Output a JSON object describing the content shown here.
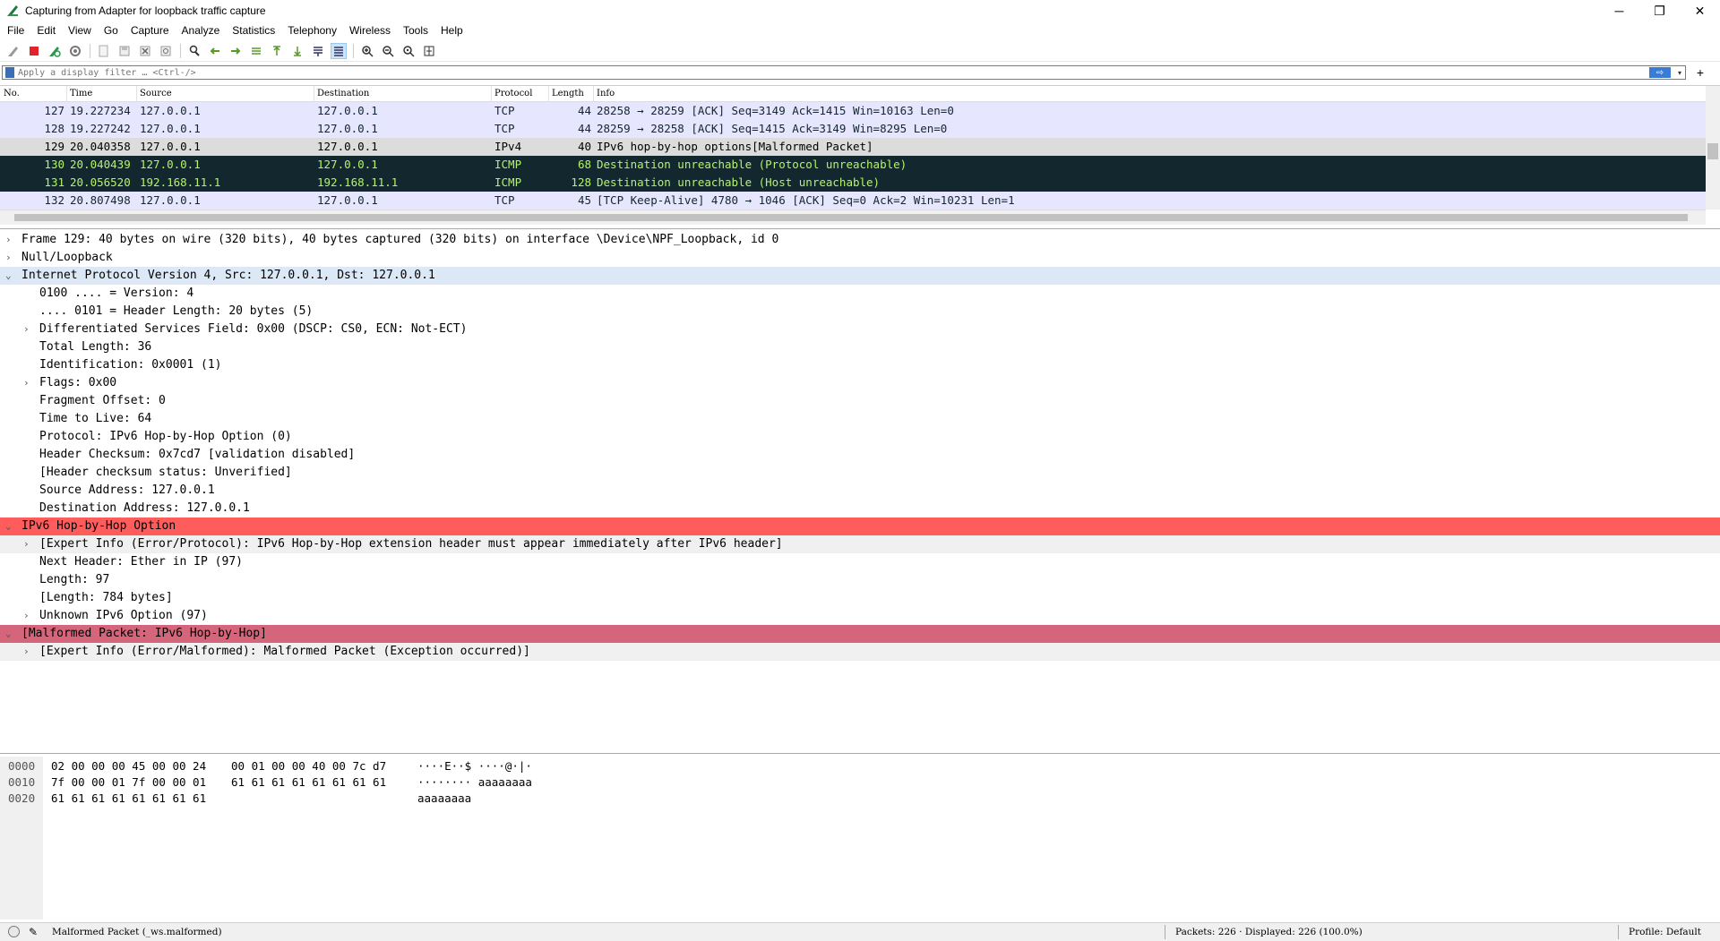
{
  "window": {
    "title": "Capturing from Adapter for loopback traffic capture",
    "minimize": "─",
    "restore": "❐",
    "close": "✕"
  },
  "menu": [
    "File",
    "Edit",
    "View",
    "Go",
    "Capture",
    "Analyze",
    "Statistics",
    "Telephony",
    "Wireless",
    "Tools",
    "Help"
  ],
  "filter": {
    "placeholder": "Apply a display filter … <Ctrl-/>",
    "plus": "+"
  },
  "packet_list": {
    "columns": [
      "No.",
      "Time",
      "Source",
      "Destination",
      "Protocol",
      "Length",
      "Info"
    ],
    "rows": [
      {
        "no": "127",
        "time": "19.227234",
        "src": "127.0.0.1",
        "dst": "127.0.0.1",
        "proto": "TCP",
        "len": "44",
        "info": "28258 → 28259 [ACK] Seq=3149 Ack=1415 Win=10163 Len=0",
        "bg": "#e7e6ff",
        "fg": "#12272e"
      },
      {
        "no": "128",
        "time": "19.227242",
        "src": "127.0.0.1",
        "dst": "127.0.0.1",
        "proto": "TCP",
        "len": "44",
        "info": "28259 → 28258 [ACK] Seq=1415 Ack=3149 Win=8295 Len=0",
        "bg": "#e7e6ff",
        "fg": "#12272e"
      },
      {
        "no": "129",
        "time": "20.040358",
        "src": "127.0.0.1",
        "dst": "127.0.0.1",
        "proto": "IPv4",
        "len": "40",
        "info": "IPv6 hop-by-hop options[Malformed Packet]",
        "bg": "#dcdcdc",
        "fg": "#000000"
      },
      {
        "no": "130",
        "time": "20.040439",
        "src": "127.0.0.1",
        "dst": "127.0.0.1",
        "proto": "ICMP",
        "len": "68",
        "info": "Destination unreachable (Protocol unreachable)",
        "bg": "#12272e",
        "fg": "#b5f466"
      },
      {
        "no": "131",
        "time": "20.056520",
        "src": "192.168.11.1",
        "dst": "192.168.11.1",
        "proto": "ICMP",
        "len": "128",
        "info": "Destination unreachable (Host unreachable)",
        "bg": "#12272e",
        "fg": "#b5f466"
      },
      {
        "no": "132",
        "time": "20.807498",
        "src": "127.0.0.1",
        "dst": "127.0.0.1",
        "proto": "TCP",
        "len": "45",
        "info": "[TCP Keep-Alive] 4780 → 1046 [ACK] Seq=0 Ack=2 Win=10231 Len=1",
        "bg": "#e7e6ff",
        "fg": "#12272e"
      }
    ]
  },
  "details": [
    {
      "indent": 0,
      "arrow": "›",
      "text": "Frame 129: 40 bytes on wire (320 bits), 40 bytes captured (320 bits) on interface \\Device\\NPF_Loopback, id 0",
      "bg": ""
    },
    {
      "indent": 0,
      "arrow": "›",
      "text": "Null/Loopback",
      "bg": ""
    },
    {
      "indent": 0,
      "arrow": "⌄",
      "text": "Internet Protocol Version 4, Src: 127.0.0.1, Dst: 127.0.0.1",
      "bg": "#dce8f5"
    },
    {
      "indent": 1,
      "arrow": "",
      "text": "0100 .... = Version: 4",
      "bg": ""
    },
    {
      "indent": 1,
      "arrow": "",
      "text": ".... 0101 = Header Length: 20 bytes (5)",
      "bg": ""
    },
    {
      "indent": 1,
      "arrow": "›",
      "text": "Differentiated Services Field: 0x00 (DSCP: CS0, ECN: Not-ECT)",
      "bg": ""
    },
    {
      "indent": 1,
      "arrow": "",
      "text": "Total Length: 36",
      "bg": ""
    },
    {
      "indent": 1,
      "arrow": "",
      "text": "Identification: 0x0001 (1)",
      "bg": ""
    },
    {
      "indent": 1,
      "arrow": "›",
      "text": "Flags: 0x00",
      "bg": ""
    },
    {
      "indent": 1,
      "arrow": "",
      "text": "Fragment Offset: 0",
      "bg": ""
    },
    {
      "indent": 1,
      "arrow": "",
      "text": "Time to Live: 64",
      "bg": ""
    },
    {
      "indent": 1,
      "arrow": "",
      "text": "Protocol: IPv6 Hop-by-Hop Option (0)",
      "bg": ""
    },
    {
      "indent": 1,
      "arrow": "",
      "text": "Header Checksum: 0x7cd7 [validation disabled]",
      "bg": ""
    },
    {
      "indent": 1,
      "arrow": "",
      "text": "[Header checksum status: Unverified]",
      "bg": ""
    },
    {
      "indent": 1,
      "arrow": "",
      "text": "Source Address: 127.0.0.1",
      "bg": ""
    },
    {
      "indent": 1,
      "arrow": "",
      "text": "Destination Address: 127.0.0.1",
      "bg": ""
    },
    {
      "indent": 0,
      "arrow": "⌄",
      "text": "IPv6 Hop-by-Hop Option",
      "bg": "#ff5c5c"
    },
    {
      "indent": 1,
      "arrow": "›",
      "text": "[Expert Info (Error/Protocol): IPv6 Hop-by-Hop extension header must appear immediately after IPv6 header]",
      "bg": "#f0f0f0"
    },
    {
      "indent": 1,
      "arrow": "",
      "text": "Next Header: Ether in IP (97)",
      "bg": ""
    },
    {
      "indent": 1,
      "arrow": "",
      "text": "Length: 97",
      "bg": ""
    },
    {
      "indent": 1,
      "arrow": "",
      "text": "[Length: 784 bytes]",
      "bg": ""
    },
    {
      "indent": 1,
      "arrow": "›",
      "text": "Unknown IPv6 Option (97)",
      "bg": ""
    },
    {
      "indent": 0,
      "arrow": "⌄",
      "text": "[Malformed Packet: IPv6 Hop-by-Hop]",
      "bg": "#d4657a"
    },
    {
      "indent": 1,
      "arrow": "›",
      "text": "[Expert Info (Error/Malformed): Malformed Packet (Exception occurred)]",
      "bg": "#f0f0f0"
    }
  ],
  "bytes": [
    {
      "offset": "0000",
      "hex1": "02 00 00 00 45 00 00 24",
      "hex2": "00 01 00 00 40 00 7c d7",
      "ascii": "····E··$ ····@·|·"
    },
    {
      "offset": "0010",
      "hex1": "7f 00 00 01 7f 00 00 01",
      "hex2": "61 61 61 61 61 61 61 61",
      "ascii": "········ aaaaaaaa"
    },
    {
      "offset": "0020",
      "hex1": "61 61 61 61 61 61 61 61",
      "hex2": "",
      "ascii": "aaaaaaaa"
    }
  ],
  "status": {
    "expert": "Malformed Packet (_ws.malformed)",
    "packets": "Packets: 226 · Displayed: 226 (100.0%)",
    "profile": "Profile: Default"
  }
}
